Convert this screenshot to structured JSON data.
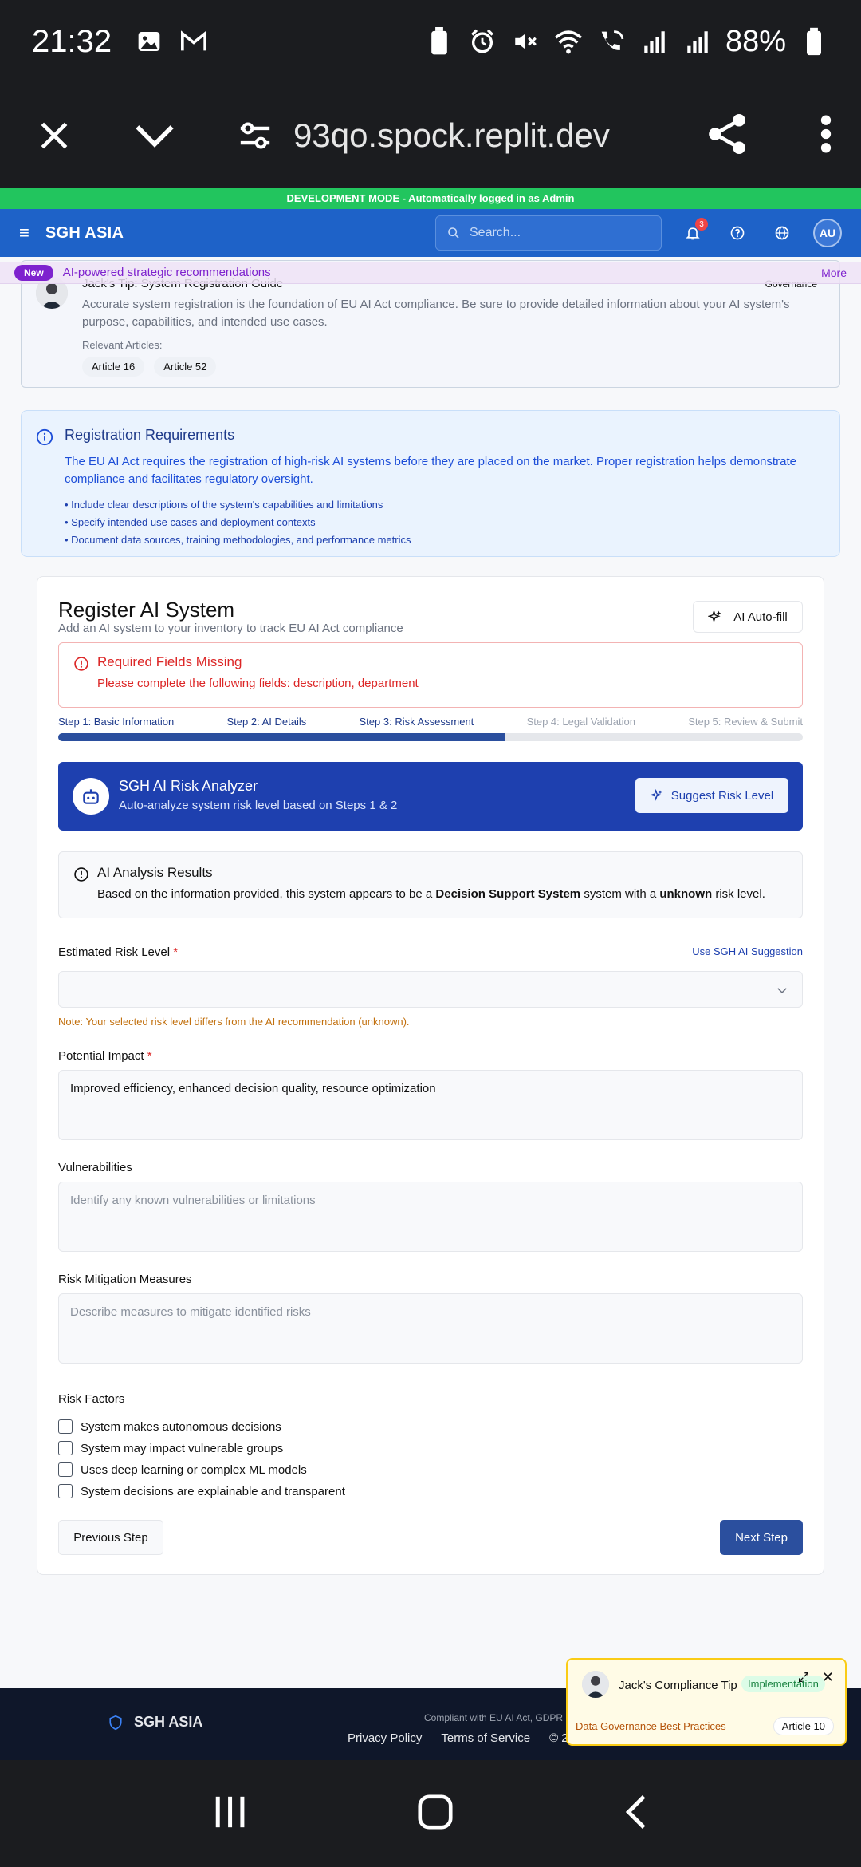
{
  "status_bar": {
    "time": "21:32",
    "battery": "88%",
    "icons": [
      "gallery-icon",
      "gmail-icon",
      "battery-saver-icon",
      "alarm-icon",
      "mute-icon",
      "wifi-icon",
      "wifi-calling-icon",
      "signal-icon",
      "signal-icon",
      "battery-icon"
    ]
  },
  "browser": {
    "url": "93qo.spock.replit.dev"
  },
  "dev_banner": "DEVELOPMENT MODE - Automatically logged in as Admin",
  "header": {
    "brand": "SGH ASIA",
    "search_placeholder": "Search...",
    "notification_count": "3",
    "avatar_initials": "AU"
  },
  "promo": {
    "badge": "New",
    "text": "AI-powered strategic recommendations",
    "more": "More"
  },
  "tip": {
    "title": "Jack's Tip: System Registration Guide",
    "tag": "Governance",
    "body": "Accurate system registration is the foundation of EU AI Act compliance. Be sure to provide detailed information about your AI system's purpose, capabilities, and intended use cases.",
    "relevant_label": "Relevant Articles:",
    "articles": [
      "Article 16",
      "Article 52"
    ]
  },
  "requirements": {
    "title": "Registration Requirements",
    "text": "The EU AI Act requires the registration of high-risk AI systems before they are placed on the market. Proper registration helps demonstrate compliance and facilitates regulatory oversight.",
    "items": [
      "• Include clear descriptions of the system's capabilities and limitations",
      "• Specify intended use cases and deployment contexts",
      "• Document data sources, training methodologies, and performance metrics"
    ]
  },
  "register": {
    "title": "Register AI System",
    "subtitle": "Add an AI system to your inventory to track EU AI Act compliance",
    "autofill_label": "AI Auto-fill",
    "missing_title": "Required Fields Missing",
    "missing_text": "Please complete the following fields: description, department",
    "steps": [
      "Step 1: Basic Information",
      "Step 2: AI Details",
      "Step 3: Risk Assessment",
      "Step 4: Legal Validation",
      "Step 5: Review & Submit"
    ],
    "current_step": 3,
    "progress_fraction": 0.6,
    "analyzer": {
      "title": "SGH AI Risk Analyzer",
      "subtitle": "Auto-analyze system risk level based on Steps 1 & 2",
      "button": "Suggest Risk Level"
    },
    "results": {
      "title": "AI Analysis Results",
      "prefix": "Based on the information provided, this system appears to be a",
      "system_type": "Decision Support System",
      "middle": "system with a",
      "risk": "unknown",
      "suffix": "risk level."
    },
    "risk_level_label": "Estimated Risk Level",
    "required_mark": "*",
    "use_ai_label": "Use SGH AI Suggestion",
    "risk_level_value": "",
    "note": "Note: Your selected risk level differs from the AI recommendation (unknown).",
    "impact_label": "Potential Impact",
    "impact_value": "Improved efficiency, enhanced decision quality, resource optimization",
    "vulnerabilities_label": "Vulnerabilities",
    "vulnerabilities_placeholder": "Identify any known vulnerabilities or limitations",
    "mitigation_label": "Risk Mitigation Measures",
    "mitigation_placeholder": "Describe measures to mitigate identified risks",
    "risk_factors_label": "Risk Factors",
    "risk_factors": [
      "System makes autonomous decisions",
      "System may impact vulnerable groups",
      "Uses deep learning or complex ML models",
      "System decisions are explainable and transparent"
    ],
    "prev_label": "Previous Step",
    "next_label": "Next Step"
  },
  "footer": {
    "brand": "SGH ASIA",
    "compliant": "Compliant with EU AI Act, GDPR",
    "links": [
      "Privacy Policy",
      "Terms of Service",
      "© 2"
    ]
  },
  "float_tip": {
    "title": "Jack's Compliance Tip",
    "badge": "Implementation",
    "close": "✕",
    "link": "Data Governance Best Practices",
    "chip": "Article 10"
  },
  "colors": {
    "brand_blue": "#1e62c8",
    "dev_green": "#22c55e",
    "analyzer_blue": "#1e40af",
    "error_red": "#dc2626"
  }
}
